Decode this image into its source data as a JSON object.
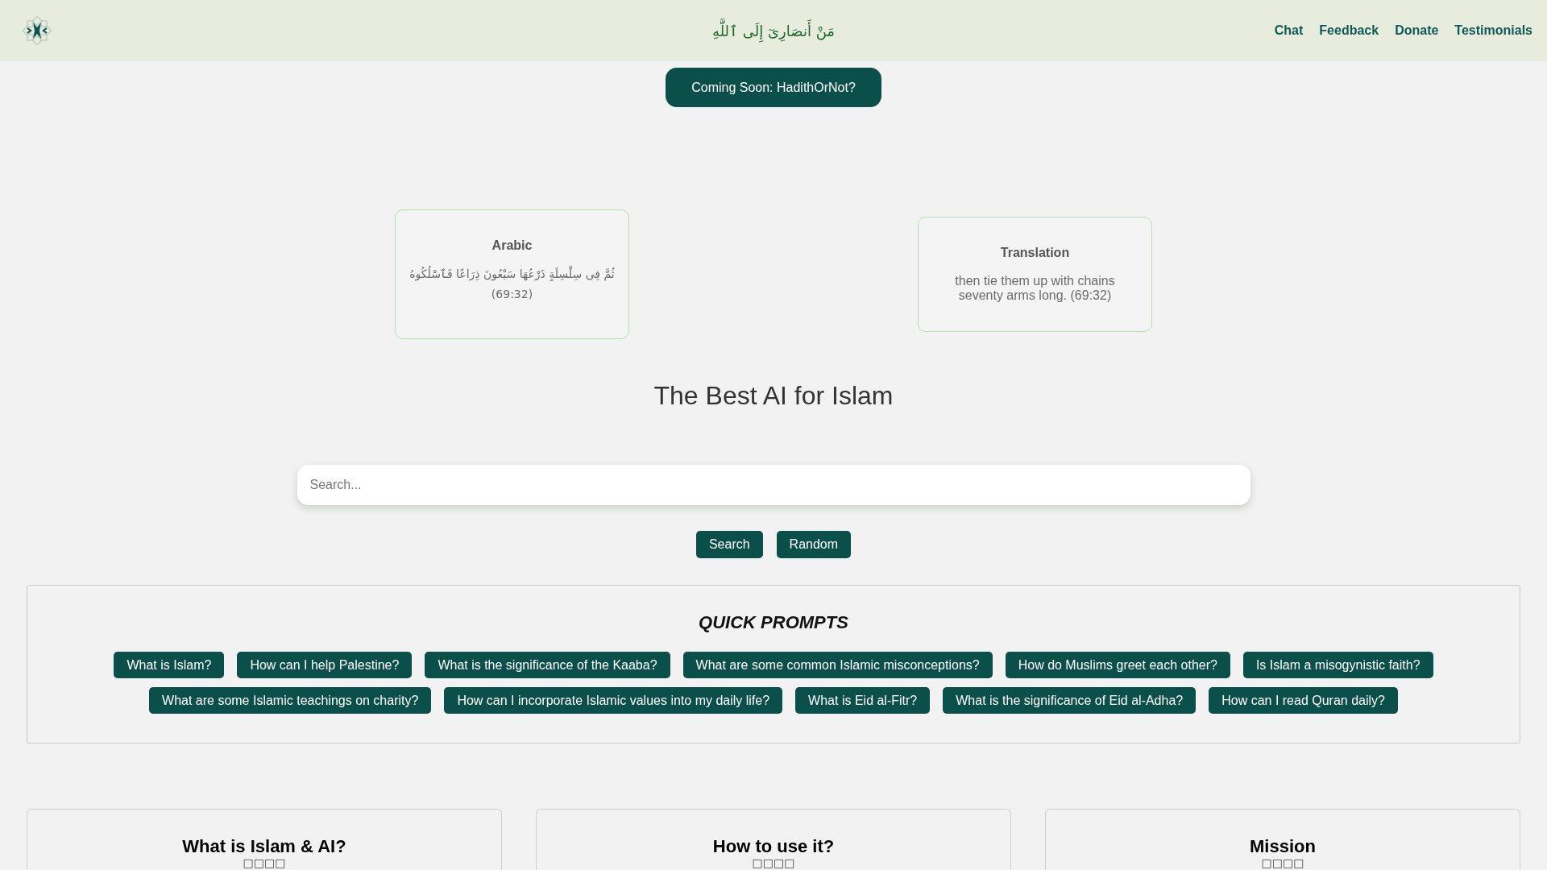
{
  "header": {
    "arabic_title": "مَنْ أَنصَارِىٓ إِلَى ٱللَّهِ",
    "nav_links": [
      "Chat",
      "Feedback",
      "Donate",
      "Testimonials"
    ]
  },
  "announcement_button": "Coming Soon: HadithOrNot?",
  "verse_cards": [
    {
      "kind": "arabic",
      "title": "Arabic",
      "text": "ثُمَّ فِى سِلْسِلَةٍ ذَرْعُهَا سَبْعُونَ ذِرَاعًا فَٱسْلُكُوهُ (69:32)"
    },
    {
      "kind": "translation",
      "title": "Translation",
      "text": "then tie them up with chains seventy arms long. (69:32)"
    }
  ],
  "heading": "The Best AI for Islam",
  "search": {
    "placeholder": "Search...",
    "buttons": [
      "Search",
      "Random"
    ]
  },
  "quick_prompts": {
    "title": "QUICK PROMPTS",
    "prompts": [
      "What is Islam?",
      "How can I help Palestine?",
      "What is the significance of the Kaaba?",
      "What are some common Islamic misconceptions?",
      "How do Muslims greet each other?",
      "Is Islam a misogynistic faith?",
      "What are some Islamic teachings on charity?",
      "How can I incorporate Islamic values into my daily life?",
      "What is Eid al-Fitr?",
      "What is the significance of Eid al-Adha?",
      "How can I read Quran daily?"
    ]
  },
  "info_cards": [
    {
      "title": "What is Islam & AI?",
      "glyphs": "□□□□"
    },
    {
      "title": "How to use it?",
      "glyphs": "□□□□"
    },
    {
      "title": "Mission",
      "glyphs": "□□□□"
    }
  ]
}
